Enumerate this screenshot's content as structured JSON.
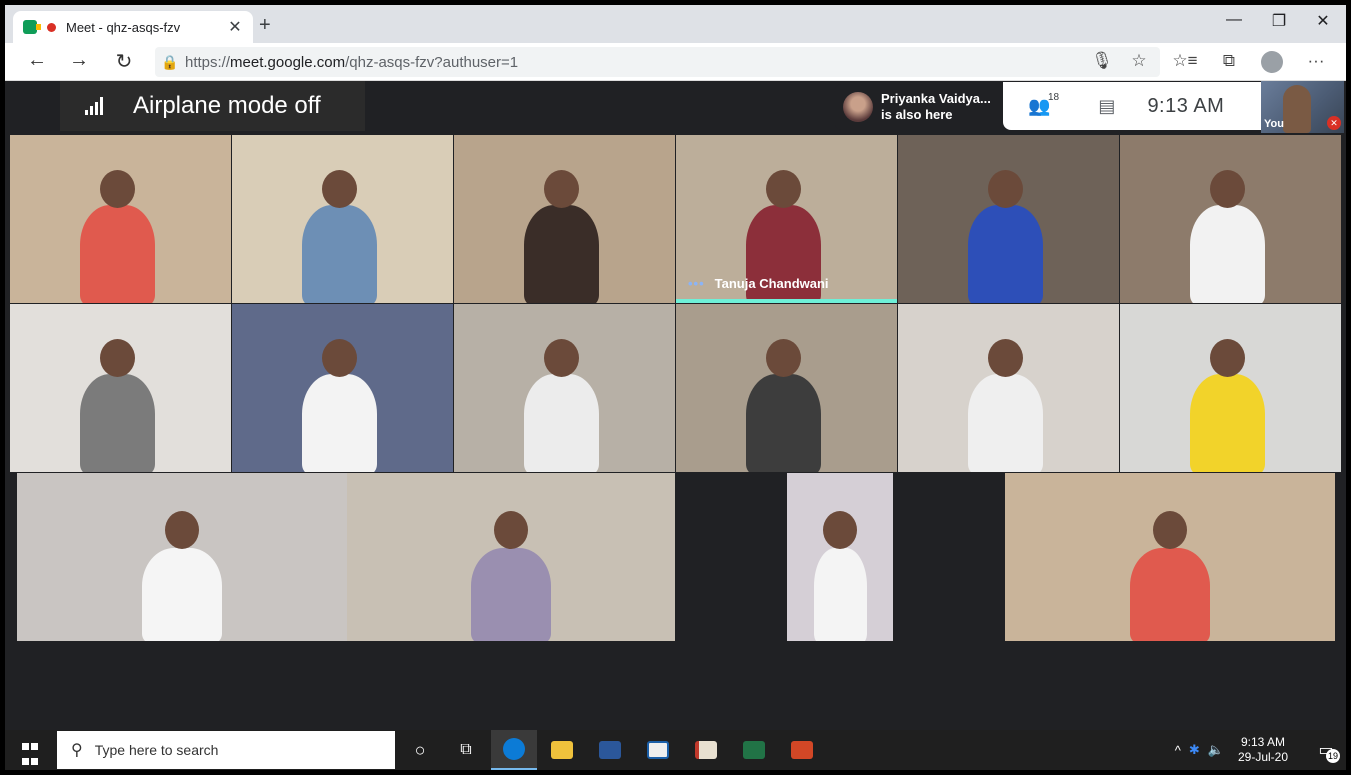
{
  "browser": {
    "tab_title": "Meet - qhz-asqs-fzv",
    "tab_close": "✕",
    "new_tab": "+",
    "window_controls": {
      "minimize": "—",
      "maximize": "❐",
      "close": "✕"
    },
    "nav": {
      "back": "←",
      "forward": "→",
      "refresh": "↻"
    },
    "url": {
      "prefix": "https://",
      "host": "meet.google.com",
      "rest": "/qhz-asqs-fzv?authuser=1"
    },
    "toolbar_icons": {
      "mic": "🎙",
      "star": "☆",
      "favorites": "☆≡",
      "collections": "⧉",
      "more": "···"
    }
  },
  "meet": {
    "airplane_text": "Airplane mode off",
    "notification": {
      "name": "Priyanka Vaidya...",
      "message": "is also here"
    },
    "participant_count": "18",
    "time": "9:13 AM",
    "self_label": "You",
    "speaker_label": "Tanuja Chandwani",
    "speaker_dots": "•••"
  },
  "tiles": [
    {
      "bg": "#c9b49a",
      "fg": "#e05a4e"
    },
    {
      "bg": "#d9cdb7",
      "fg": "#6d8fb5"
    },
    {
      "bg": "#b8a48c",
      "fg": "#3a2d28"
    },
    {
      "bg": "#bcae9a",
      "fg": "#8c2f3a"
    },
    {
      "bg": "#6e6258",
      "fg": "#2d4fb8"
    },
    {
      "bg": "#8d7b6b",
      "fg": "#f2f2f2"
    },
    {
      "bg": "#e2dfdb",
      "fg": "#7b7b7b"
    },
    {
      "bg": "#5f6a8a",
      "fg": "#f3f3f3"
    },
    {
      "bg": "#b7b0a6",
      "fg": "#ececec"
    },
    {
      "bg": "#a99d8d",
      "fg": "#3d3d3d"
    },
    {
      "bg": "#d7d2cc",
      "fg": "#efefef"
    },
    {
      "bg": "#d8d8d6",
      "fg": "#f2d32a"
    },
    {
      "bg": "#c9c5c2",
      "fg": "#f5f5f5"
    },
    {
      "bg": "#c8c0b4",
      "fg": "#9a8fb0"
    },
    {
      "bg": "#d5cfd6",
      "fg": "#f4f4f4"
    }
  ],
  "taskbar": {
    "search_placeholder": "Type here to search",
    "clock_time": "9:13 AM",
    "clock_date": "29-Jul-20",
    "notification_count": "19",
    "tray": {
      "chevron": "^",
      "bluetooth": "✱",
      "volume": "🔈"
    },
    "apps": [
      {
        "name": "cortana",
        "glyph": "○"
      },
      {
        "name": "task-view",
        "glyph": "⧉"
      }
    ],
    "app_colors": {
      "edge": "#0c7bd6",
      "explorer": "#f0c23c",
      "word": "#2b579a",
      "solitaire": "#eeeeee",
      "book": "#e8e0d0",
      "excel": "#217346",
      "powerpoint": "#d24726"
    }
  }
}
